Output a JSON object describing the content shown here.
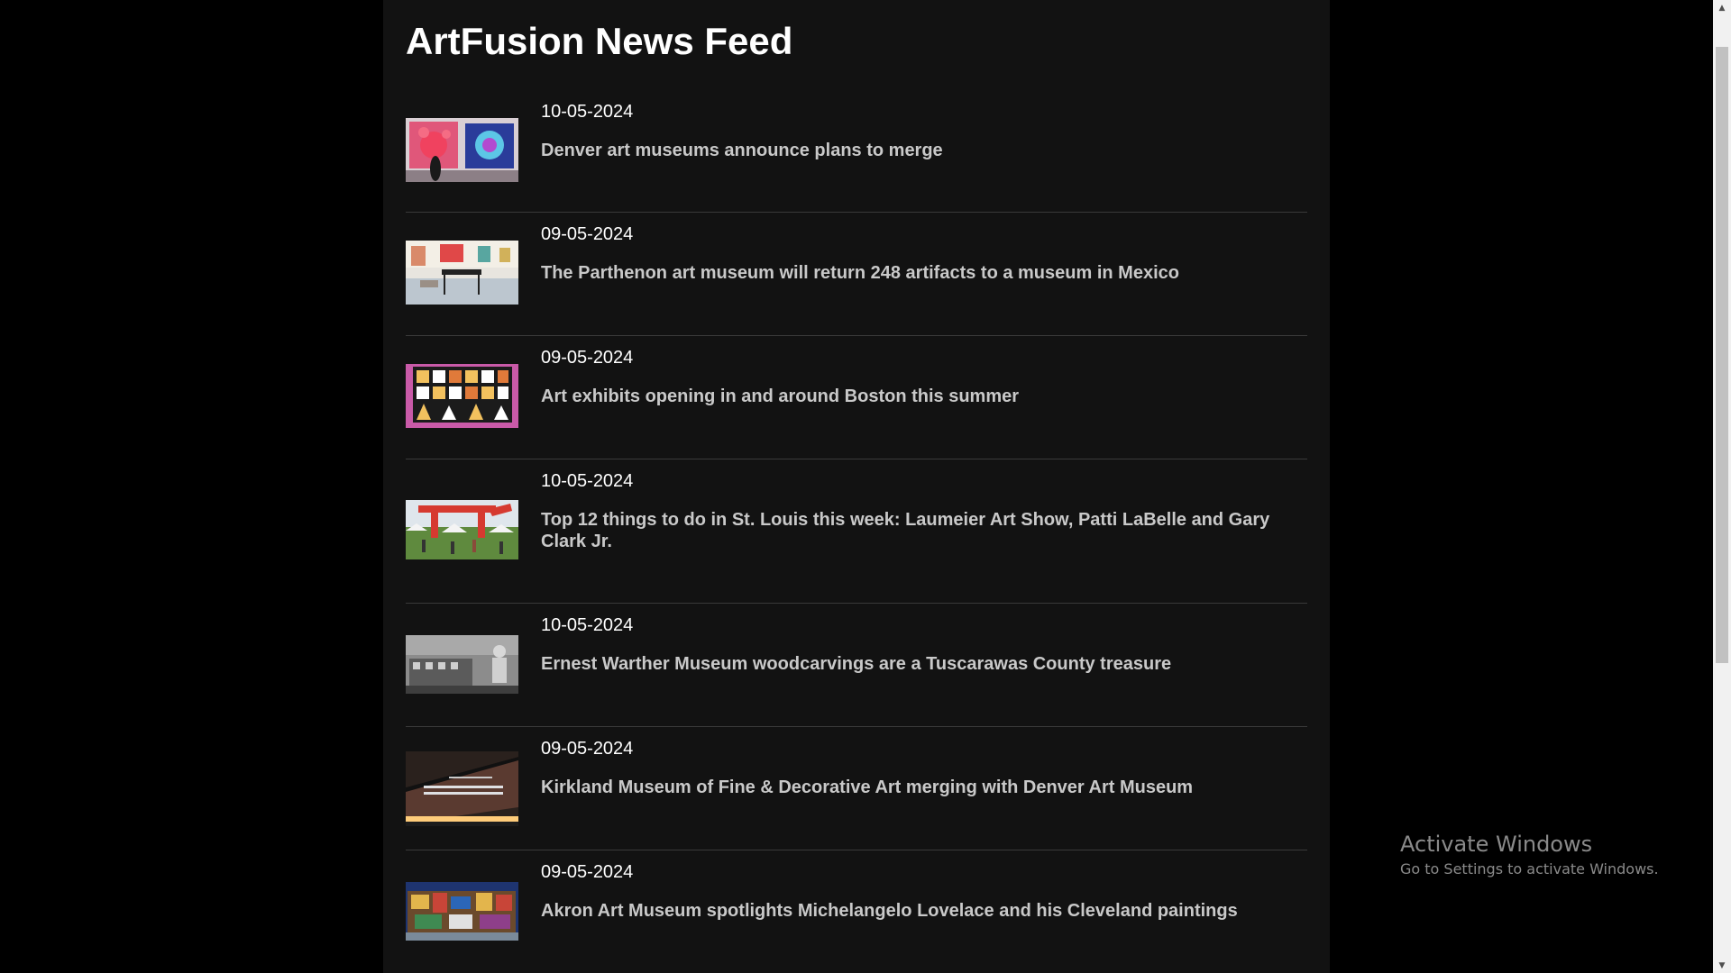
{
  "feed": {
    "title": "ArtFusion News Feed",
    "items": [
      {
        "date": "10-05-2024",
        "headline": "Denver art museums announce plans to merge",
        "image_icon": "art-gallery-photo"
      },
      {
        "date": "09-05-2024",
        "headline": "The Parthenon art museum will return 248 artifacts to a museum in Mexico",
        "image_icon": "museum-room-photo"
      },
      {
        "date": "09-05-2024",
        "headline": "Art exhibits opening in and around Boston this summer",
        "image_icon": "quilt-artwork-photo"
      },
      {
        "date": "10-05-2024",
        "headline": "Top 12 things to do in St. Louis this week: Laumeier Art Show, Patti LaBelle and Gary Clark Jr.",
        "image_icon": "outdoor-sculpture-photo"
      },
      {
        "date": "10-05-2024",
        "headline": "Ernest Warther Museum woodcarvings are a Tuscarawas County treasure",
        "image_icon": "woodcarver-photo"
      },
      {
        "date": "09-05-2024",
        "headline": "Kirkland Museum of Fine & Decorative Art merging with Denver Art Museum",
        "image_icon": "museum-sign-photo"
      },
      {
        "date": "09-05-2024",
        "headline": "Akron Art Museum spotlights Michelangelo Lovelace and his Cleveland paintings",
        "image_icon": "city-painting-photo"
      }
    ]
  },
  "watermark": {
    "title": "Activate Windows",
    "subtitle": "Go to Settings to activate Windows."
  },
  "colors": {
    "page_bg": "#000000",
    "feed_bg": "#121212",
    "title": "#ffffff",
    "date": "#ffffff",
    "headline": "#c9c9c9",
    "divider": "#3a3a3a"
  }
}
